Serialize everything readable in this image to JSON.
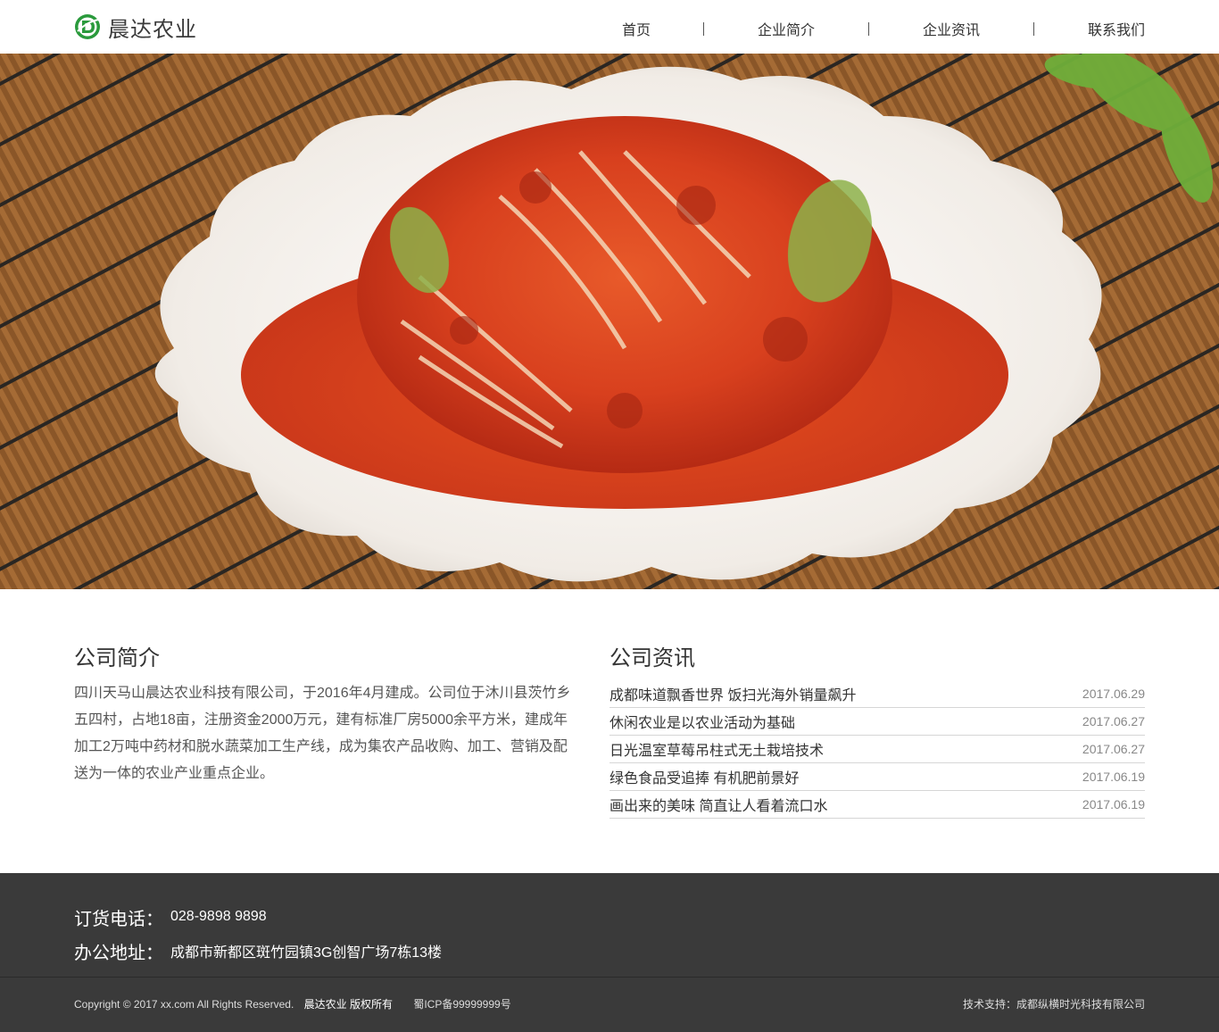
{
  "header": {
    "logo_text": "晨达农业",
    "nav": [
      "首页",
      "企业简介",
      "企业资讯",
      "联系我们"
    ]
  },
  "banner": {
    "image": "kimchi-plate-photo"
  },
  "about": {
    "title": "公司简介",
    "text": "四川天马山晨达农业科技有限公司，于2016年4月建成。公司位于沐川县茨竹乡五四村，占地18亩，注册资金2000万元，建有标准厂房5000余平方米，建成年加工2万吨中药材和脱水蔬菜加工生产线，成为集农产品收购、加工、营销及配送为一体的农业产业重点企业。"
  },
  "news": {
    "title": "公司资讯",
    "items": [
      {
        "title": "成都味道飘香世界 饭扫光海外销量飙升",
        "date": "2017.06.29"
      },
      {
        "title": "休闲农业是以农业活动为基础",
        "date": "2017.06.27"
      },
      {
        "title": "日光温室草莓吊柱式无土栽培技术",
        "date": "2017.06.27"
      },
      {
        "title": "绿色食品受追捧 有机肥前景好",
        "date": "2017.06.19"
      },
      {
        "title": "画出来的美味 简直让人看着流口水",
        "date": "2017.06.19"
      }
    ]
  },
  "footer": {
    "phone_label": "订货电话：",
    "phone_value": "028-9898 9898",
    "address_label": "办公地址：",
    "address_value": "成都市新都区斑竹园镇3G创智广场7栋13楼",
    "copyright": "Copyright © 2017 xx.com All Rights Reserved.",
    "brand_rights": "晨达农业 版权所有",
    "icp": "蜀ICP备99999999号",
    "tech_support": "技术支持：成都纵横时光科技有限公司"
  },
  "colors": {
    "logo_green": "#2a9a3c",
    "footer_bg": "#3a3a3a",
    "kimchi_red": "#d8401e"
  }
}
